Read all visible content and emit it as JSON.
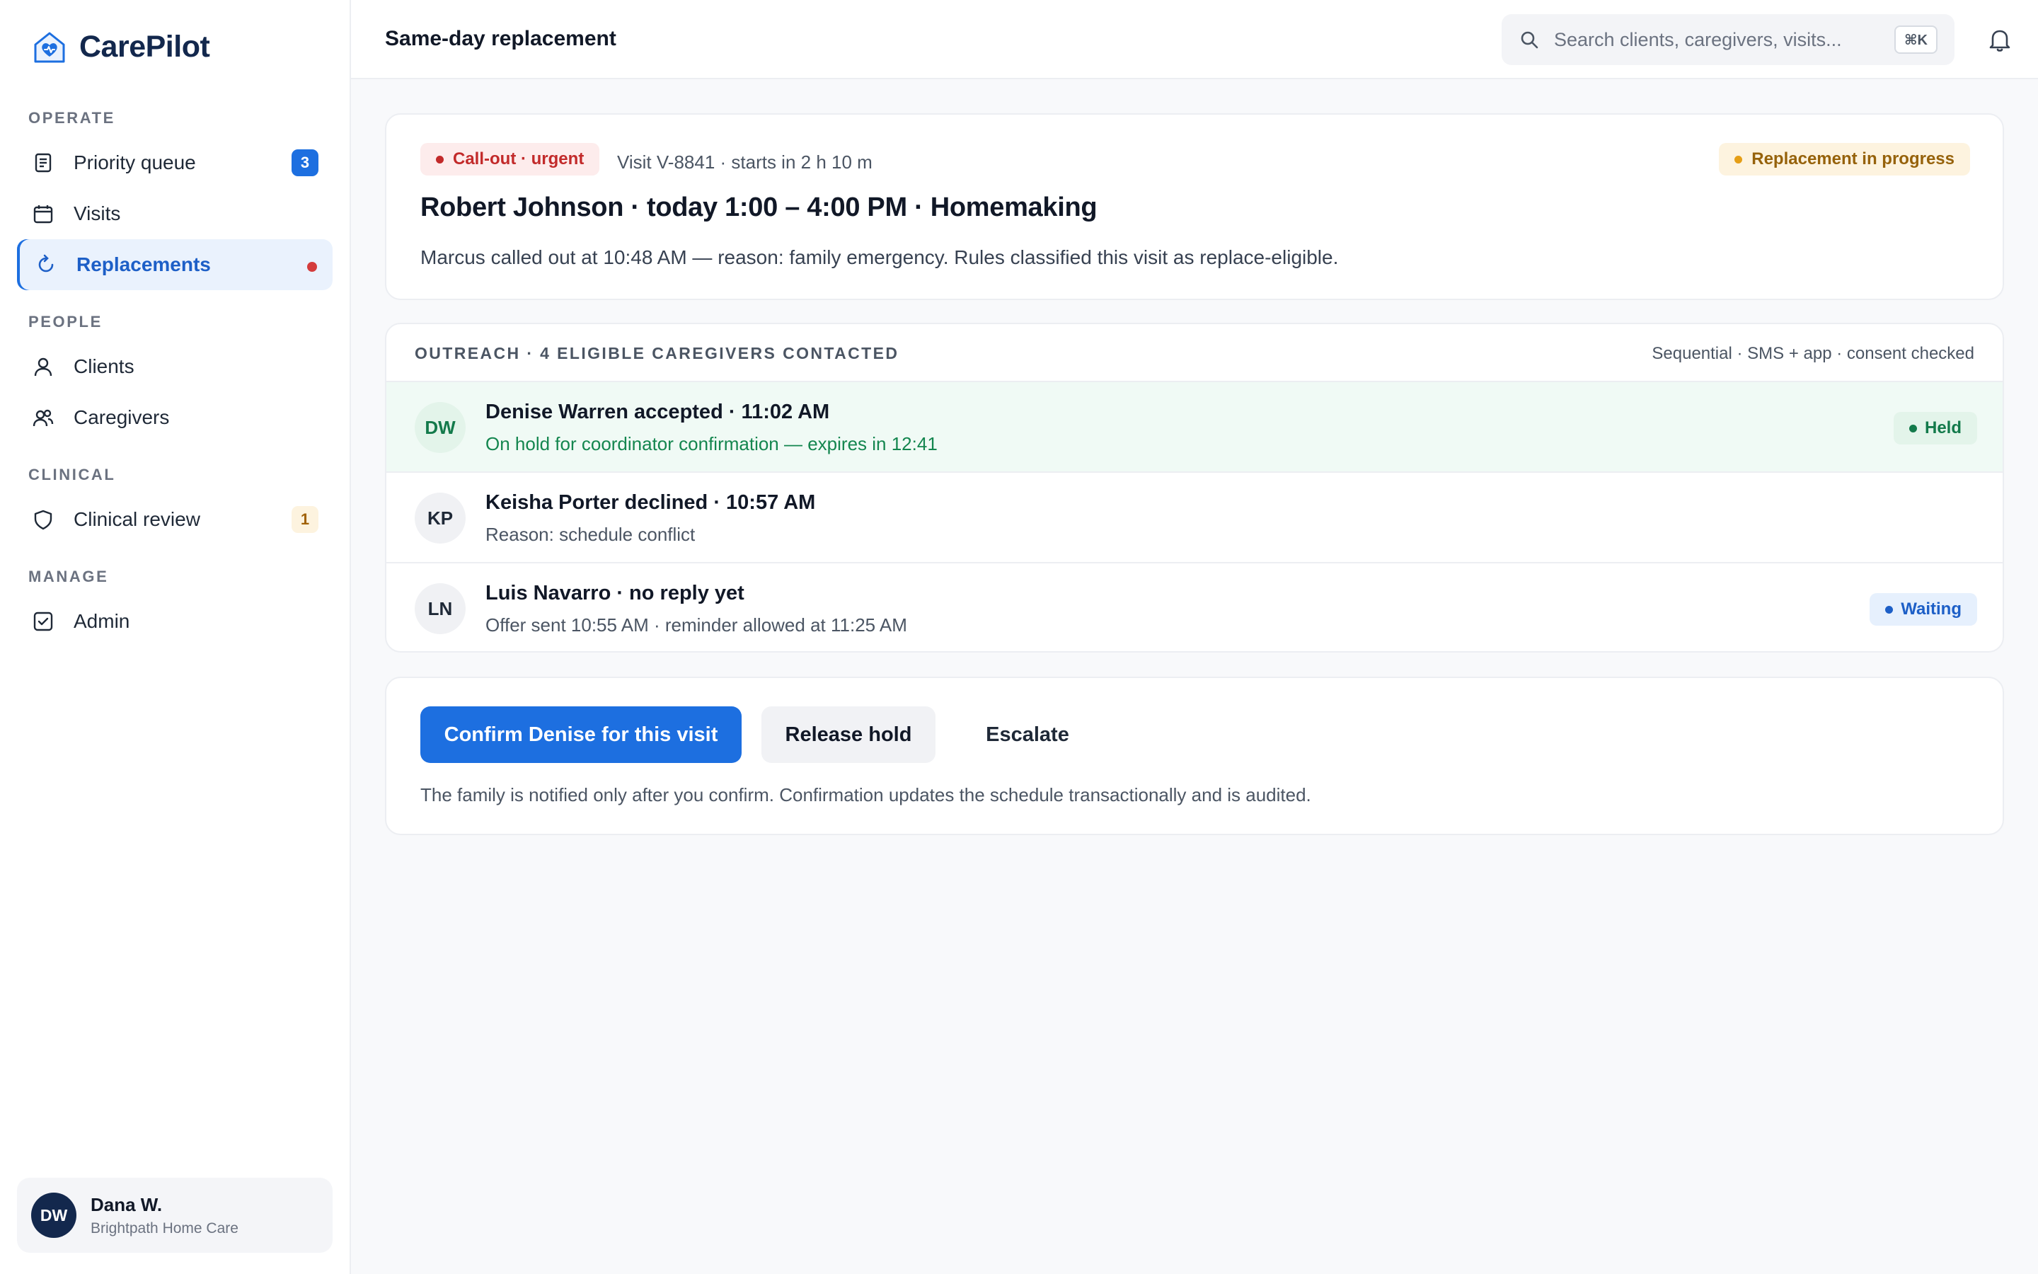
{
  "brand": {
    "name": "CarePilot"
  },
  "sidebar": {
    "sections": {
      "operate": "OPERATE",
      "people": "PEOPLE",
      "clinical": "CLINICAL",
      "manage": "MANAGE"
    },
    "items": [
      {
        "label": "Priority queue",
        "icon": "document-list-icon",
        "badge": "3"
      },
      {
        "label": "Visits",
        "icon": "calendar-icon"
      },
      {
        "label": "Replacements",
        "icon": "refresh-icon",
        "active": true,
        "dot": true
      },
      {
        "label": "Clients",
        "icon": "person-icon"
      },
      {
        "label": "Caregivers",
        "icon": "people-icon"
      },
      {
        "label": "Clinical review",
        "icon": "shield-icon",
        "badge": "1"
      },
      {
        "label": "Admin",
        "icon": "checkbox-icon"
      }
    ]
  },
  "user": {
    "initials": "DW",
    "name": "Dana W.",
    "org": "Brightpath Home Care"
  },
  "header": {
    "title": "Same-day replacement",
    "search_placeholder": "Search clients, caregivers, visits...",
    "search_shortcut": "⌘K"
  },
  "visit": {
    "urgency": "Call-out · urgent",
    "meta": "Visit V-8841 · starts in 2 h 10 m",
    "status": "Replacement in progress",
    "title": "Robert Johnson · today 1:00 – 4:00 PM · Homemaking",
    "description": "Marcus called out at 10:48 AM — reason: family emergency. Rules classified this visit as replace-eligible."
  },
  "outreach": {
    "heading": "OUTREACH · 4 ELIGIBLE CAREGIVERS CONTACTED",
    "meta": "Sequential · SMS + app · consent checked",
    "rows": [
      {
        "initials": "DW",
        "title": "Denise Warren accepted · 11:02 AM",
        "subtitle": "On hold for coordinator confirmation — expires in 12:41",
        "status": "Held"
      },
      {
        "initials": "KP",
        "title": "Keisha Porter declined · 10:57 AM",
        "subtitle": "Reason: schedule conflict",
        "status": ""
      },
      {
        "initials": "LN",
        "title": "Luis Navarro · no reply yet",
        "subtitle": "Offer sent 10:55 AM · reminder allowed at 11:25 AM",
        "status": "Waiting"
      }
    ]
  },
  "actions": {
    "confirm": "Confirm Denise for this visit",
    "release": "Release hold",
    "escalate": "Escalate",
    "note": "The family is notified only after you confirm. Confirmation updates the schedule transactionally and is audited."
  },
  "colors": {
    "accent": "#1d6fe0",
    "brand_navy": "#13284d",
    "urgent": "#c22a2a",
    "held": "#137a4b",
    "warning": "#96620b"
  }
}
